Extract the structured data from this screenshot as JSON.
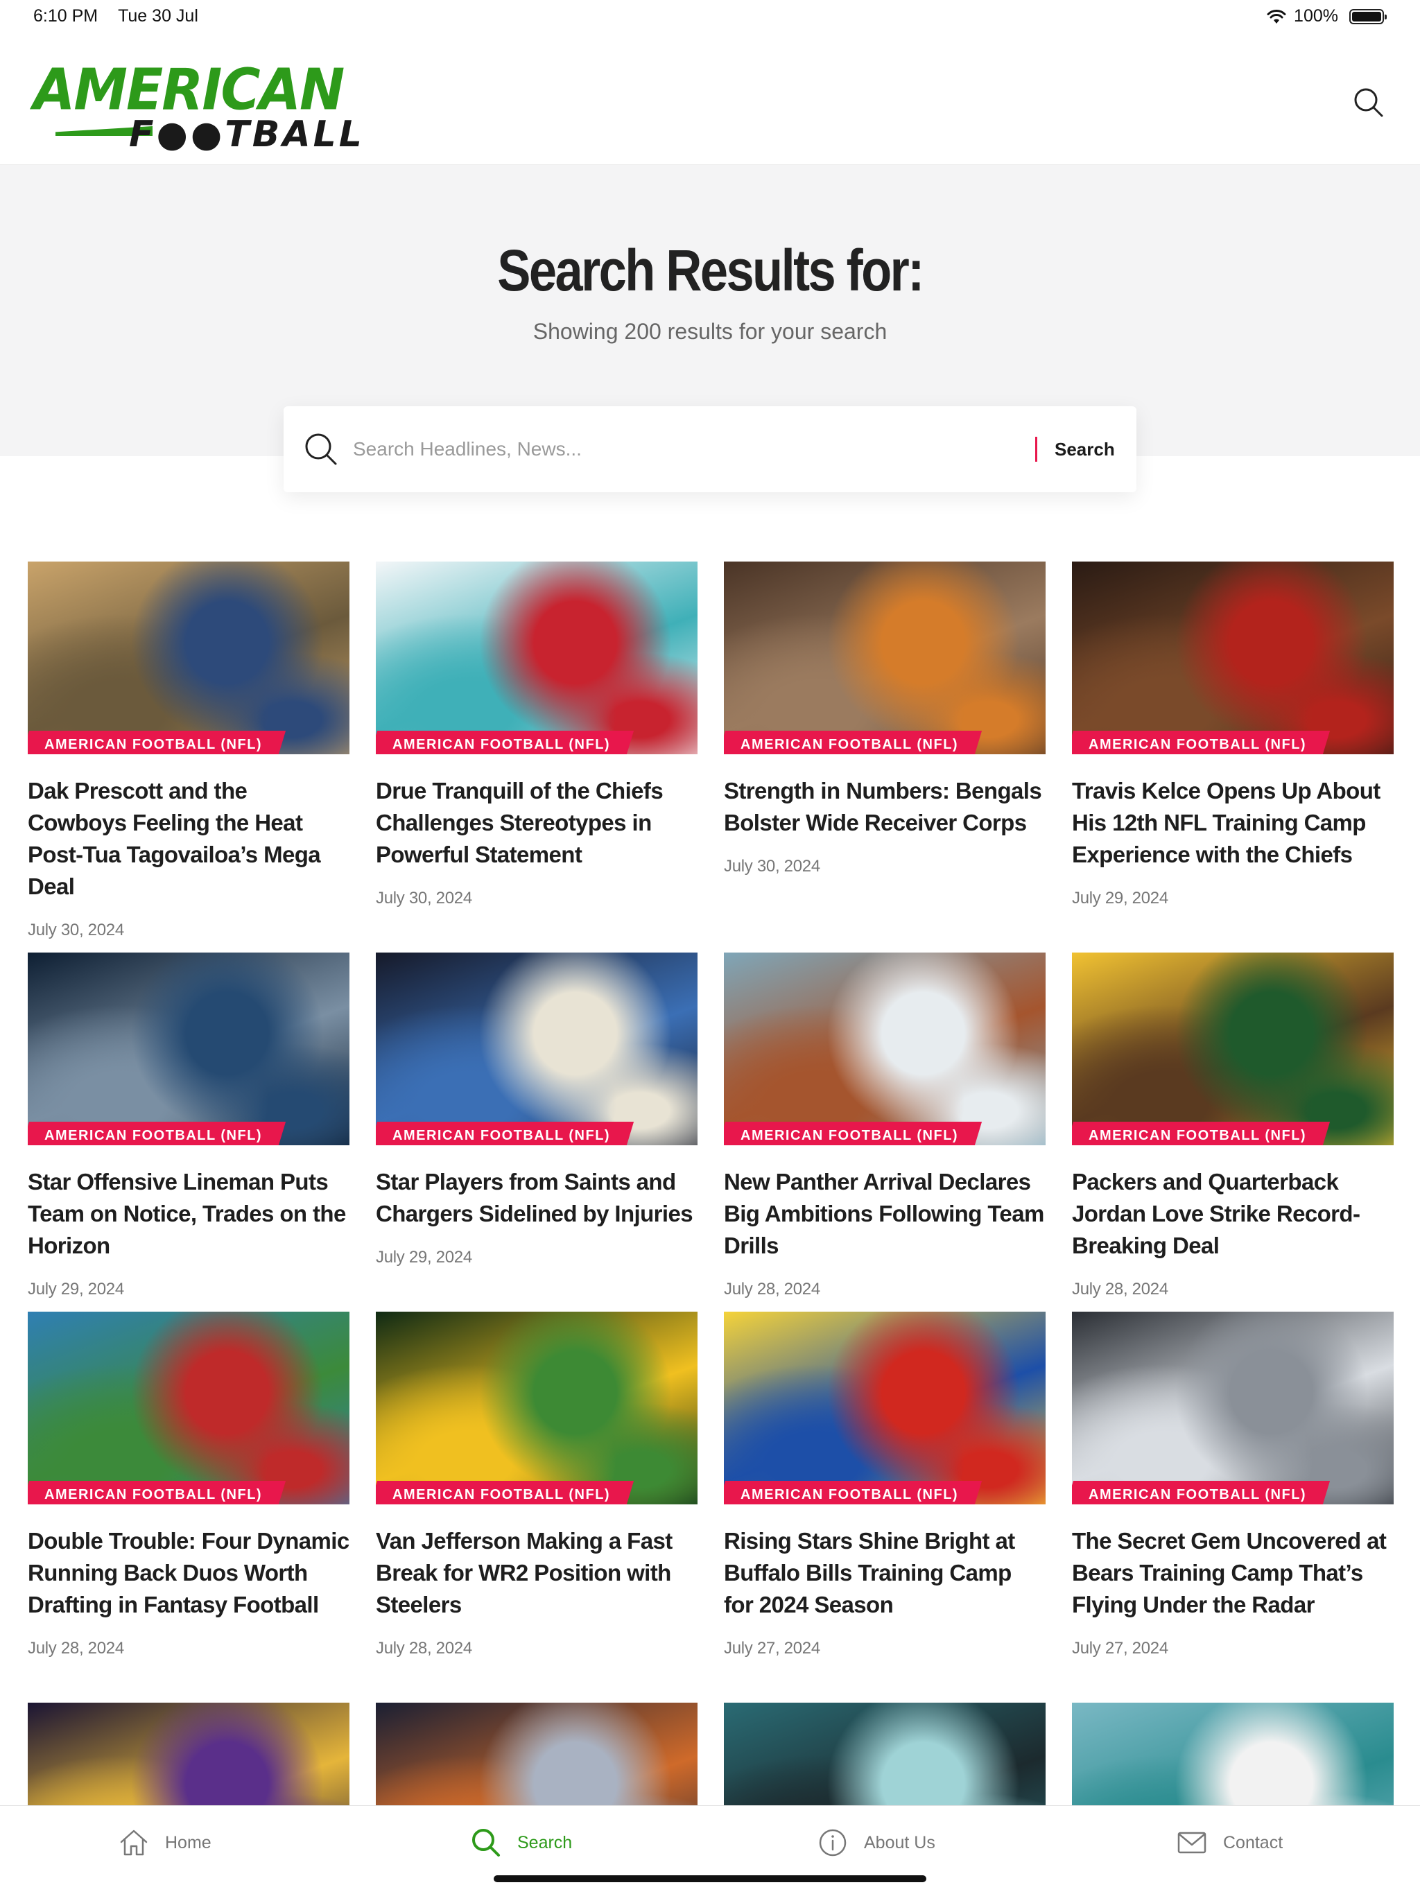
{
  "status_bar": {
    "time": "6:10 PM",
    "date": "Tue 30 Jul",
    "battery": "100%"
  },
  "header": {
    "logo_line1": "AMERICAN",
    "logo_line2": "F●●TBALL"
  },
  "hero": {
    "title": "Search Results for:",
    "subtitle": "Showing 200 results for your search"
  },
  "search": {
    "placeholder": "Search Headlines, News...",
    "button": "Search",
    "value": ""
  },
  "category_label": "AMERICAN FOOTBALL (NFL)",
  "articles": [
    {
      "title": "Dak Prescott and the Cowboys Feeling the Heat Post-Tua Tagovailoa’s Mega Deal",
      "date": "July 30, 2024",
      "category": "AMERICAN FOOTBALL (NFL)",
      "colors": [
        "#c9a36a",
        "#2d4a7a",
        "#6b5a3c"
      ]
    },
    {
      "title": "Drue Tranquill of the Chiefs Challenges Stereotypes in Powerful Statement",
      "date": "July 30, 2024",
      "category": "AMERICAN FOOTBALL (NFL)",
      "colors": [
        "#f3f6f8",
        "#c8232f",
        "#3fb0b8"
      ]
    },
    {
      "title": "Strength in Numbers: Bengals Bolster Wide Receiver Corps",
      "date": "July 30, 2024",
      "category": "AMERICAN FOOTBALL (NFL)",
      "colors": [
        "#4a3426",
        "#d57c2a",
        "#9b7b5f"
      ]
    },
    {
      "title": "Travis Kelce Opens Up About His 12th NFL Training Camp Experience with the Chiefs",
      "date": "July 29, 2024",
      "category": "AMERICAN FOOTBALL (NFL)",
      "colors": [
        "#2a1b14",
        "#b3231c",
        "#7a4a2a"
      ]
    },
    {
      "title": "Star Offensive Lineman Puts Team on Notice, Trades on the Horizon",
      "date": "July 29, 2024",
      "category": "AMERICAN FOOTBALL (NFL)",
      "colors": [
        "#0e1f33",
        "#254a72",
        "#7a8fa3"
      ]
    },
    {
      "title": "Star Players from Saints and Chargers Sidelined by Injuries",
      "date": "July 29, 2024",
      "category": "AMERICAN FOOTBALL (NFL)",
      "colors": [
        "#161a2a",
        "#e8e3d4",
        "#3b6fb5"
      ]
    },
    {
      "title": "New Panther Arrival Declares Big Ambitions Following Team Drills",
      "date": "July 28, 2024",
      "category": "AMERICAN FOOTBALL (NFL)",
      "colors": [
        "#7fa6b8",
        "#e7ecef",
        "#a5552e"
      ]
    },
    {
      "title": "Packers and Quarterback Jordan Love Strike Record-Breaking Deal",
      "date": "July 28, 2024",
      "category": "AMERICAN FOOTBALL (NFL)",
      "colors": [
        "#f1c232",
        "#1f5a2c",
        "#5a3a20"
      ]
    },
    {
      "title": "Double Trouble: Four Dynamic Running Back Duos Worth Drafting in Fantasy Football",
      "date": "July 28, 2024",
      "category": "AMERICAN FOOTBALL (NFL)",
      "colors": [
        "#2f7fb3",
        "#bf2a2a",
        "#3c8a3a"
      ]
    },
    {
      "title": "Van Jefferson Making a Fast Break for WR2 Position with Steelers",
      "date": "July 28, 2024",
      "category": "AMERICAN FOOTBALL (NFL)",
      "colors": [
        "#0f2a14",
        "#3d8a34",
        "#f0c020"
      ]
    },
    {
      "title": "Rising Stars Shine Bright at Buffalo Bills Training Camp for 2024 Season",
      "date": "July 27, 2024",
      "category": "AMERICAN FOOTBALL (NFL)",
      "colors": [
        "#f5d33a",
        "#d1281f",
        "#1d4fa8"
      ]
    },
    {
      "title": "The Secret Gem Uncovered at Bears Training Camp That’s Flying Under the Radar",
      "date": "July 27, 2024",
      "category": "AMERICAN FOOTBALL (NFL)",
      "colors": [
        "#2b2f35",
        "#8a9098",
        "#d9dde2"
      ]
    },
    {
      "title": "",
      "date": "",
      "category": "",
      "colors": [
        "#1a1433",
        "#5a2f8a",
        "#e5b53a"
      ]
    },
    {
      "title": "",
      "date": "",
      "category": "",
      "colors": [
        "#1a1f33",
        "#a9b2c2",
        "#cf6a2a"
      ]
    },
    {
      "title": "",
      "date": "",
      "category": "",
      "colors": [
        "#2a6b74",
        "#9fd3d6",
        "#1c2a2e"
      ]
    },
    {
      "title": "",
      "date": "",
      "category": "",
      "colors": [
        "#7ab8c4",
        "#f2f2f2",
        "#2a8c8f"
      ]
    }
  ],
  "tabs": [
    {
      "label": "Home",
      "icon": "home-icon",
      "active": false
    },
    {
      "label": "Search",
      "icon": "search-icon",
      "active": true
    },
    {
      "label": "About Us",
      "icon": "info-icon",
      "active": false
    },
    {
      "label": "Contact",
      "icon": "mail-icon",
      "active": false
    }
  ],
  "colors": {
    "accent": "#e8174c",
    "brand": "#2d9a1a",
    "hero_bg": "#f4f4f5"
  }
}
